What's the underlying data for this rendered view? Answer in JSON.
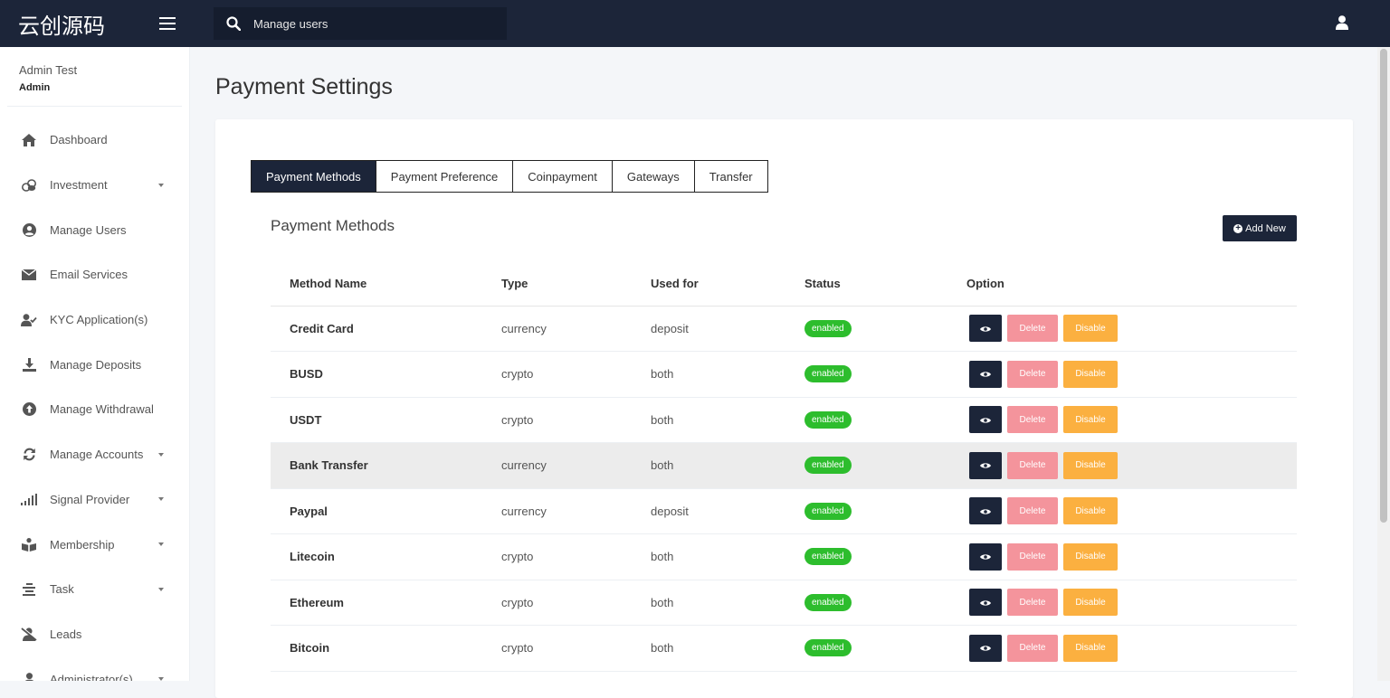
{
  "brand": {
    "logo_text": "云创源码"
  },
  "search": {
    "placeholder": "Manage users"
  },
  "profile": {
    "name": "Admin Test",
    "role": "Admin"
  },
  "sidebar": {
    "items": [
      {
        "label": "Dashboard",
        "icon": "home-icon",
        "has_submenu": false
      },
      {
        "label": "Investment",
        "icon": "coins-icon",
        "has_submenu": true
      },
      {
        "label": "Manage Users",
        "icon": "user-circle-icon",
        "has_submenu": false
      },
      {
        "label": "Email Services",
        "icon": "envelope-icon",
        "has_submenu": false
      },
      {
        "label": "KYC Application(s)",
        "icon": "user-check-icon",
        "has_submenu": false
      },
      {
        "label": "Manage Deposits",
        "icon": "download-icon",
        "has_submenu": false
      },
      {
        "label": "Manage Withdrawal",
        "icon": "arrow-up-circle-icon",
        "has_submenu": false
      },
      {
        "label": "Manage Accounts",
        "icon": "sync-icon",
        "has_submenu": true
      },
      {
        "label": "Signal Provider",
        "icon": "signal-icon",
        "has_submenu": true
      },
      {
        "label": "Membership",
        "icon": "book-reader-icon",
        "has_submenu": true
      },
      {
        "label": "Task",
        "icon": "list-icon",
        "has_submenu": true
      },
      {
        "label": "Leads",
        "icon": "user-slash-icon",
        "has_submenu": false
      },
      {
        "label": "Administrator(s)",
        "icon": "user-icon",
        "has_submenu": true
      }
    ]
  },
  "page": {
    "title": "Payment Settings"
  },
  "tabs": [
    {
      "label": "Payment Methods",
      "active": true
    },
    {
      "label": "Payment Preference",
      "active": false
    },
    {
      "label": "Coinpayment",
      "active": false
    },
    {
      "label": "Gateways",
      "active": false
    },
    {
      "label": "Transfer",
      "active": false
    }
  ],
  "section": {
    "title": "Payment Methods",
    "add_button": "Add New"
  },
  "table": {
    "headers": [
      "Method Name",
      "Type",
      "Used for",
      "Status",
      "Option"
    ],
    "rows": [
      {
        "name": "Credit Card",
        "type": "currency",
        "used_for": "deposit",
        "status": "enabled"
      },
      {
        "name": "BUSD",
        "type": "crypto",
        "used_for": "both",
        "status": "enabled"
      },
      {
        "name": "USDT",
        "type": "crypto",
        "used_for": "both",
        "status": "enabled"
      },
      {
        "name": "Bank Transfer",
        "type": "currency",
        "used_for": "both",
        "status": "enabled"
      },
      {
        "name": "Paypal",
        "type": "currency",
        "used_for": "deposit",
        "status": "enabled"
      },
      {
        "name": "Litecoin",
        "type": "crypto",
        "used_for": "both",
        "status": "enabled"
      },
      {
        "name": "Ethereum",
        "type": "crypto",
        "used_for": "both",
        "status": "enabled"
      },
      {
        "name": "Bitcoin",
        "type": "crypto",
        "used_for": "both",
        "status": "enabled"
      }
    ],
    "highlighted_row": 3,
    "actions": {
      "view_icon": "eye-icon",
      "delete_label": "Delete",
      "disable_label": "Disable"
    }
  },
  "colors": {
    "topbar": "#1c2539",
    "enabled_badge": "#2dbd2d",
    "delete_button": "#f4949c",
    "disable_button": "#fbb040"
  }
}
